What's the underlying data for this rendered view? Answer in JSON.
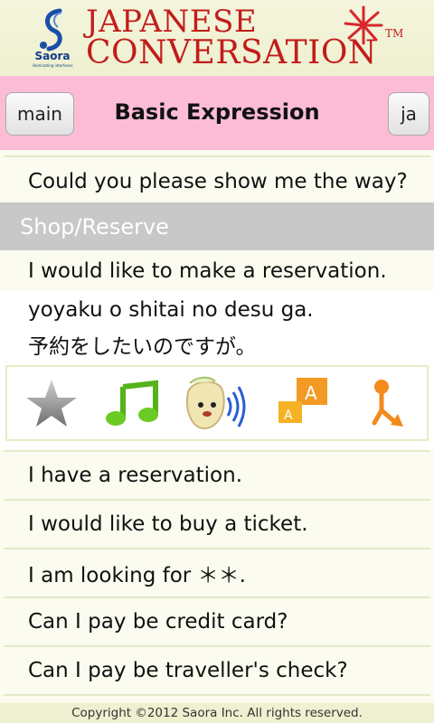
{
  "banner": {
    "logo_text": "Saora",
    "logo_sub": "illuminating interfaces",
    "title_line1": "JAPANESE",
    "title_line2": "CONVERSATION",
    "trademark": "TM"
  },
  "header": {
    "left_button": "main",
    "title": "Basic Expression",
    "right_button": "ja"
  },
  "phrases_top": [
    "Could you please show me the way?"
  ],
  "section": {
    "label": "Shop/Reserve"
  },
  "selected": {
    "english": "I would like to make a reservation.",
    "romaji": "yoyaku o shitai no desu ga.",
    "japanese": "予約をしたいのですが。"
  },
  "toolbar": {
    "icons": [
      "star-icon",
      "music-note-icon",
      "speaker-character-icon",
      "translate-icon",
      "navigate-icon"
    ]
  },
  "phrases": [
    "I have a reservation.",
    "I would like to buy a ticket.",
    "I am looking for ＊＊.",
    "Can I pay be credit card?",
    "Can I pay be traveller's check?"
  ],
  "footer": {
    "copyright": "Copyright ©2012 Saora Inc. All rights reserved."
  },
  "colors": {
    "banner_bg": "#eef0cf",
    "header_bg": "#fcbcd6",
    "title_red": "#c21c1c",
    "section_bg": "#c8c8c8",
    "list_bg": "#fbfcef"
  }
}
